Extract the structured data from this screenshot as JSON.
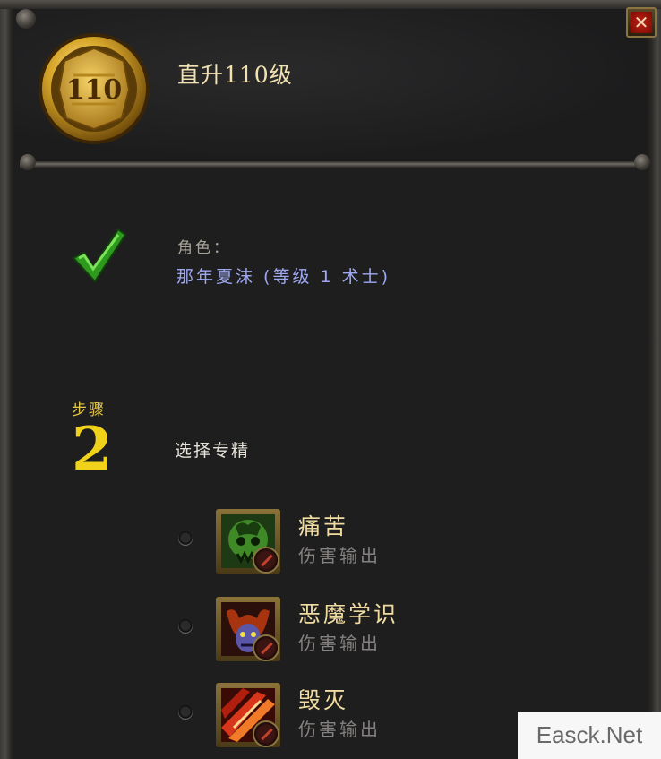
{
  "header": {
    "title": "直升110级",
    "medal_text": "110",
    "close_label": "✕"
  },
  "character": {
    "label": "角色：",
    "value": "那年夏沫 (等级 1 术士)",
    "complete": true
  },
  "step": {
    "label": "步骤",
    "number": "2",
    "title": "选择专精"
  },
  "specs": [
    {
      "name": "痛苦",
      "role": "伤害输出",
      "icon": "affliction-icon",
      "selected": false
    },
    {
      "name": "恶魔学识",
      "role": "伤害输出",
      "icon": "demonology-icon",
      "selected": false
    },
    {
      "name": "毁灭",
      "role": "伤害输出",
      "icon": "destruction-icon",
      "selected": false
    }
  ],
  "watermark": "Easck.Net",
  "colors": {
    "title": "#f2e2b0",
    "character_value": "#9ea8f0",
    "step_number": "#f1d21a",
    "role_text": "#858280",
    "check": "#39c02a"
  }
}
